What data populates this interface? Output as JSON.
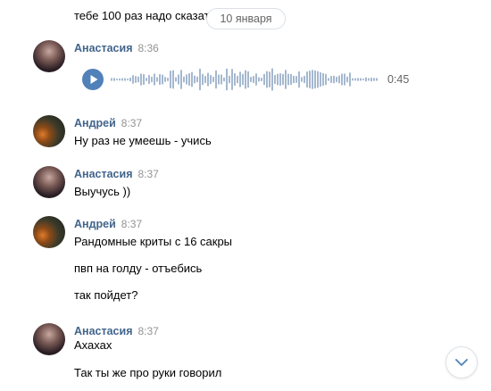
{
  "top_message_fragment": "тебе 100 раз надо сказат",
  "date_separator": "10 января",
  "messages": [
    {
      "author": "Анастасия",
      "time": "8:36",
      "voice_duration": "0:45"
    },
    {
      "author": "Андрей",
      "time": "8:37",
      "lines": [
        "Ну раз не умеешь - учись"
      ]
    },
    {
      "author": "Анастасия",
      "time": "8:37",
      "lines": [
        "Выучусь ))"
      ]
    },
    {
      "author": "Андрей",
      "time": "8:37",
      "lines": [
        "Рандомные криты с 16 сакры",
        "пвп на голду - отъебись",
        "так пойдет?"
      ]
    },
    {
      "author": "Анастасия",
      "time": "8:37",
      "lines": [
        "Ахахах",
        "Так ты же про руки говорил"
      ]
    }
  ],
  "icons": {
    "play": "play-icon",
    "scroll_down": "chevron-down-icon"
  },
  "colors": {
    "accent": "#5181b8",
    "name": "#42648b",
    "time": "#939393"
  }
}
